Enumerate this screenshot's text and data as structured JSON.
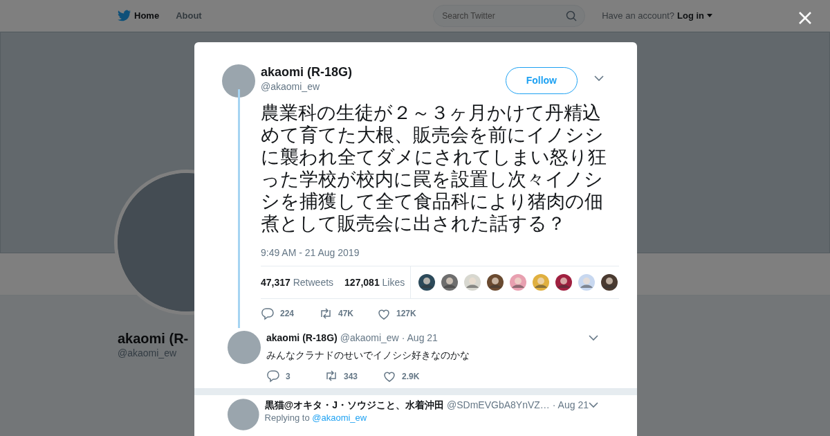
{
  "top_nav": {
    "links": [
      {
        "label": "Home",
        "selected": true
      },
      {
        "label": "About",
        "selected": false
      }
    ],
    "search": {
      "placeholder": "Search Twitter"
    },
    "account_prompt": "Have an account?",
    "login": "Log in"
  },
  "profile": {
    "name": "akaomi (R-",
    "handle": "@akaomi_ew"
  },
  "tweet": {
    "name": "akaomi (R-18G)",
    "handle": "@akaomi_ew",
    "follow": "Follow",
    "text": "農業科の生徒が２～３ヶ月かけて丹精込めて育てた大根、販売会を前にイノシシに襲われ全てダメにされてしまい怒り狂った学校が校内に罠を設置し次々イノシシを捕獲して全て食品科により猪肉の佃煮として販売会に出された話する？",
    "time": "9:49 AM - 21 Aug 2019",
    "retweets_count": "47,317",
    "retweets_label": "Retweets",
    "likes_count": "127,081",
    "likes_label": "Likes",
    "actions": {
      "replies": "224",
      "retweets": "47K",
      "likes": "127K"
    }
  },
  "replies": [
    {
      "name": "akaomi (R-18G)",
      "handle": "@akaomi_ew",
      "date": "· Aug 21",
      "text": "みんなクラナドのせいでイノシシ好きなのかな",
      "actions": {
        "replies": "3",
        "retweets": "343",
        "likes": "2.9K"
      }
    },
    {
      "name": "黒猫@オキタ・J・ソウジこと、水着沖田",
      "handle": "@SDmEVGbA8YnVZ…",
      "date": "· Aug 21",
      "replying_label": "Replying to",
      "replying_to": "@akaomi_ew"
    }
  ]
}
